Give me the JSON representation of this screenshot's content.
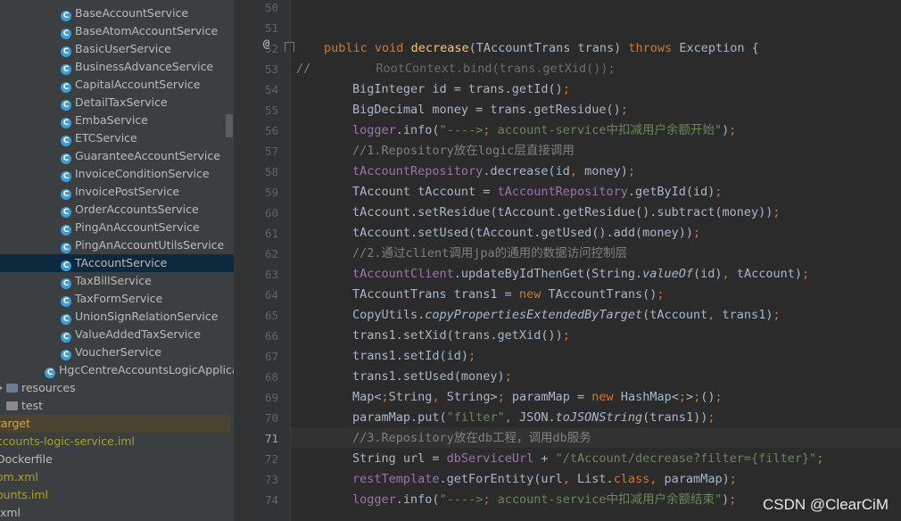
{
  "project_tree": {
    "items": [
      {
        "icon": "class-icon",
        "label": "BaseAccountService"
      },
      {
        "icon": "class-icon",
        "label": "BaseAtomAccountService"
      },
      {
        "icon": "class-icon",
        "label": "BasicUserService"
      },
      {
        "icon": "class-icon",
        "label": "BusinessAdvanceService"
      },
      {
        "icon": "class-icon",
        "label": "CapitalAccountService"
      },
      {
        "icon": "class-icon",
        "label": "DetailTaxService"
      },
      {
        "icon": "class-icon",
        "label": "EmbaService"
      },
      {
        "icon": "class-icon",
        "label": "ETCService"
      },
      {
        "icon": "class-icon",
        "label": "GuaranteeAccountService"
      },
      {
        "icon": "class-icon",
        "label": "InvoiceConditionService"
      },
      {
        "icon": "class-icon",
        "label": "InvoicePostService"
      },
      {
        "icon": "class-icon",
        "label": "OrderAccountsService"
      },
      {
        "icon": "class-icon",
        "label": "PingAnAccountService"
      },
      {
        "icon": "class-icon",
        "label": "PingAnAccountUtilsService"
      },
      {
        "icon": "class-icon",
        "label": "TAccountService",
        "selected": true
      },
      {
        "icon": "class-icon",
        "label": "TaxBillService"
      },
      {
        "icon": "class-icon",
        "label": "TaxFormService"
      },
      {
        "icon": "class-icon",
        "label": "UnionSignRelationService"
      },
      {
        "icon": "class-icon",
        "label": "ValueAddedTaxService"
      },
      {
        "icon": "class-icon",
        "label": "VoucherService"
      },
      {
        "icon": "spring-class-icon",
        "label": "HgcCentreAccountsLogicApplicati"
      },
      {
        "icon": "folder-icon",
        "label": "resources"
      },
      {
        "icon": "folder-icon",
        "label": "test"
      },
      {
        "icon": "none",
        "label": "target",
        "color": "#d0a54a"
      },
      {
        "icon": "none",
        "label": "ccounts-logic-service.iml",
        "color": "#a6a224"
      },
      {
        "icon": "none",
        "label": "Dockerfile"
      },
      {
        "icon": "none",
        "label": "om.xml",
        "color": "#a6a224"
      },
      {
        "icon": "none",
        "label": "ounts.iml",
        "color": "#a6a224"
      },
      {
        "icon": "none",
        "label": ".xml"
      }
    ]
  },
  "editor": {
    "lines": [
      {
        "n": "50",
        "code": ""
      },
      {
        "n": "51",
        "code": ""
      },
      {
        "n": "52",
        "code": "public void decrease(TAccountTrans trans) throws Exception {"
      },
      {
        "n": "53",
        "code": "//        RootContext.bind(trans.getXid());"
      },
      {
        "n": "54",
        "code": "BigInteger id = trans.getId();"
      },
      {
        "n": "55",
        "code": "BigDecimal money = trans.getResidue();"
      },
      {
        "n": "56",
        "code": "logger.info(\"----> account-service中扣减用户余额开始\");"
      },
      {
        "n": "57",
        "code": "//1.Repository放在logic层直接调用"
      },
      {
        "n": "58",
        "code": "tAccountRepository.decrease(id, money);"
      },
      {
        "n": "59",
        "code": "TAccount tAccount = tAccountRepository.getById(id);"
      },
      {
        "n": "60",
        "code": "tAccount.setResidue(tAccount.getResidue().subtract(money));"
      },
      {
        "n": "61",
        "code": "tAccount.setUsed(tAccount.getUsed().add(money));"
      },
      {
        "n": "62",
        "code": "//2.通过client调用jpa的通用的数据访问控制层"
      },
      {
        "n": "63",
        "code": "tAccountClient.updateByIdThenGet(String.valueOf(id), tAccount);"
      },
      {
        "n": "64",
        "code": "TAccountTrans trans1 = new TAccountTrans();"
      },
      {
        "n": "65",
        "code": "CopyUtils.copyPropertiesExtendedByTarget(tAccount, trans1);"
      },
      {
        "n": "66",
        "code": "trans1.setXid(trans.getXid());"
      },
      {
        "n": "67",
        "code": "trans1.setId(id);"
      },
      {
        "n": "68",
        "code": "trans1.setUsed(money);"
      },
      {
        "n": "69",
        "code": "Map<String, String> paramMap = new HashMap<>();"
      },
      {
        "n": "70",
        "code": "paramMap.put(\"filter\", JSON.toJSONString(trans1));"
      },
      {
        "n": "71",
        "code": "//3.Repository放在db工程，调用db服务"
      },
      {
        "n": "72",
        "code": "String url = dbServiceUrl + \"/tAccount/decrease?filter={filter}\";"
      },
      {
        "n": "73",
        "code": "restTemplate.getForEntity(url, List.class, paramMap);"
      },
      {
        "n": "74",
        "code": "logger.info(\"----> account-service中扣减用户余额结束\");"
      }
    ],
    "current_line": "71",
    "gutter_annotation": "@"
  },
  "watermark": "CSDN @ClearCiM",
  "colors": {
    "keyword": "#cc7832",
    "method_decl": "#ffc66d",
    "string": "#6a8759",
    "comment": "#808080",
    "field": "#9876aa",
    "plain": "#a9b7c6",
    "background": "#2b2b2b",
    "sidebar": "#3c3f41",
    "selection": "#0d293e"
  }
}
